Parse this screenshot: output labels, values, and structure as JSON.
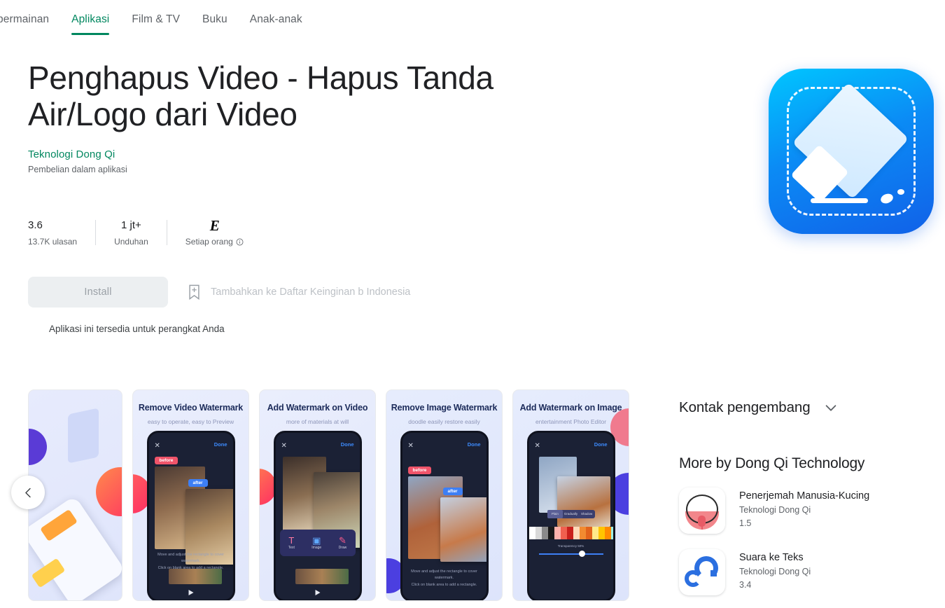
{
  "tabs": [
    {
      "label": "permainan",
      "active": false
    },
    {
      "label": "Aplikasi",
      "active": true
    },
    {
      "label": "Film & TV",
      "active": false
    },
    {
      "label": "Buku",
      "active": false
    },
    {
      "label": "Anak-anak",
      "active": false
    }
  ],
  "app": {
    "title": "Penghapus Video - Hapus Tanda Air/Logo dari Video",
    "developer": "Teknologi Dong Qi",
    "in_app_purchases": "Pembelian dalam aplikasi",
    "icon_name": "eraser-app-icon"
  },
  "stats": {
    "rating_value": "3.6",
    "rating_sub": "13.7K ulasan",
    "downloads_value": "1 jt+",
    "downloads_sub": "Unduhan",
    "content_rating_badge": "E",
    "content_rating_sub": "Setiap orang"
  },
  "actions": {
    "install_label": "Install",
    "wishlist_label": "Tambahkan ke Daftar Keinginan b Indonesia",
    "device_note": "Aplikasi ini tersedia untuk perangkat Anda"
  },
  "carousel": {
    "prev_label": "Sebelumnya",
    "shots": [
      {
        "title": "",
        "subtitle": "",
        "kind": "hero-partial"
      },
      {
        "title": "Remove Video Watermark",
        "subtitle": "easy to operate,  easy to Preview",
        "kind": "remove-video"
      },
      {
        "title": "Add Watermark on Video",
        "subtitle": "more of materials at will",
        "kind": "add-video"
      },
      {
        "title": "Remove Image Watermark",
        "subtitle": "doodle easily restore easily",
        "kind": "remove-image"
      },
      {
        "title": "Add Watermark on Image",
        "subtitle": "entertainment Photo Editor",
        "kind": "add-image"
      }
    ],
    "phone_ui": {
      "close": "✕",
      "done": "Done",
      "before": "before",
      "after": "after",
      "hint_line1": "Move and adjust the rectangle to cover watermark.",
      "hint_line2": "Click on blank area to add a rectangle.",
      "toolbar": [
        {
          "label": "Text",
          "glyph": "T"
        },
        {
          "label": "Image",
          "glyph": "▣"
        },
        {
          "label": "Draw",
          "glyph": "✎"
        }
      ],
      "segments": [
        "Plain",
        "Gradually",
        "Shadow"
      ],
      "transparency_label": "Transparency 50%"
    }
  },
  "rail": {
    "contact_heading": "Kontak pengembang",
    "more_heading": "More by Dong Qi Technology",
    "apps": [
      {
        "name": "Penerjemah Manusia-Kucing",
        "developer": "Teknologi Dong Qi",
        "rating": "1.5",
        "icon_name": "cat-translator-icon"
      },
      {
        "name": "Suara ke Teks",
        "developer": "Teknologi Dong Qi",
        "rating": "3.4",
        "icon_name": "speech-to-text-icon"
      }
    ]
  },
  "colors": {
    "accent_green": "#01875f",
    "text_primary": "#202124",
    "text_secondary": "#5f6368",
    "install_disabled_bg": "#eceff1"
  }
}
